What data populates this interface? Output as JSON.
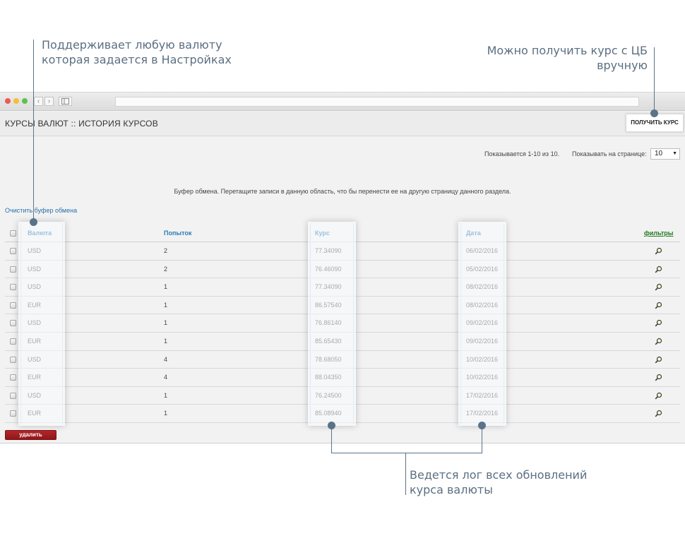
{
  "callouts": {
    "currency": [
      "Поддерживает любую валюту",
      "которая задается в Настройках"
    ],
    "cbr": [
      "Можно получить курс с ЦБ",
      "вручную"
    ],
    "log": [
      "Ведется лог всех обновлений",
      "курса валюты"
    ]
  },
  "header": {
    "title": "КУРСЫ ВАЛЮТ :: ИСТОРИЯ КУРСОВ",
    "get_rate_button": "ПОЛУЧИТЬ КУРС"
  },
  "pager": {
    "info": "Показывается 1-10 из 10.",
    "per_page_label": "Показывать на странице:",
    "per_page_value": "10"
  },
  "buffer": {
    "note": "Буфер обмена. Перетащите записи в данную область, что бы перенести ее на другую страницу данного раздела.",
    "clear_link": "Очистить буфер обмена"
  },
  "table": {
    "headers": {
      "currency": "Валюта",
      "attempts": "Попыток",
      "rate": "Курс",
      "date": "Дата",
      "filters": "фильтры"
    },
    "rows": [
      {
        "currency": "USD",
        "attempts": "2",
        "rate": "77.34090",
        "date": "06/02/2016"
      },
      {
        "currency": "USD",
        "attempts": "2",
        "rate": "76.46090",
        "date": "05/02/2016"
      },
      {
        "currency": "USD",
        "attempts": "1",
        "rate": "77.34090",
        "date": "08/02/2016"
      },
      {
        "currency": "EUR",
        "attempts": "1",
        "rate": "86.57540",
        "date": "08/02/2016"
      },
      {
        "currency": "USD",
        "attempts": "1",
        "rate": "76.86140",
        "date": "09/02/2016"
      },
      {
        "currency": "EUR",
        "attempts": "1",
        "rate": "85.65430",
        "date": "09/02/2016"
      },
      {
        "currency": "USD",
        "attempts": "4",
        "rate": "78.68050",
        "date": "10/02/2016"
      },
      {
        "currency": "EUR",
        "attempts": "4",
        "rate": "88.04350",
        "date": "10/02/2016"
      },
      {
        "currency": "USD",
        "attempts": "1",
        "rate": "76.24500",
        "date": "17/02/2016"
      },
      {
        "currency": "EUR",
        "attempts": "1",
        "rate": "85.08940",
        "date": "17/02/2016"
      }
    ]
  },
  "actions": {
    "delete_button": "удалить"
  },
  "colors": {
    "link": "#2d7bb8",
    "filter_link": "#1f7a1f",
    "delete_button": "#a01f22",
    "callout": "#5b7388",
    "traffic_red": "#ee5a4f",
    "traffic_yellow": "#f4be3a",
    "traffic_green": "#5fc24a"
  },
  "icons": {
    "row_action": "magnifier-icon",
    "nav_back": "chevron-left-icon",
    "nav_forward": "chevron-right-icon",
    "sidebar_toggle": "sidebar-icon"
  }
}
